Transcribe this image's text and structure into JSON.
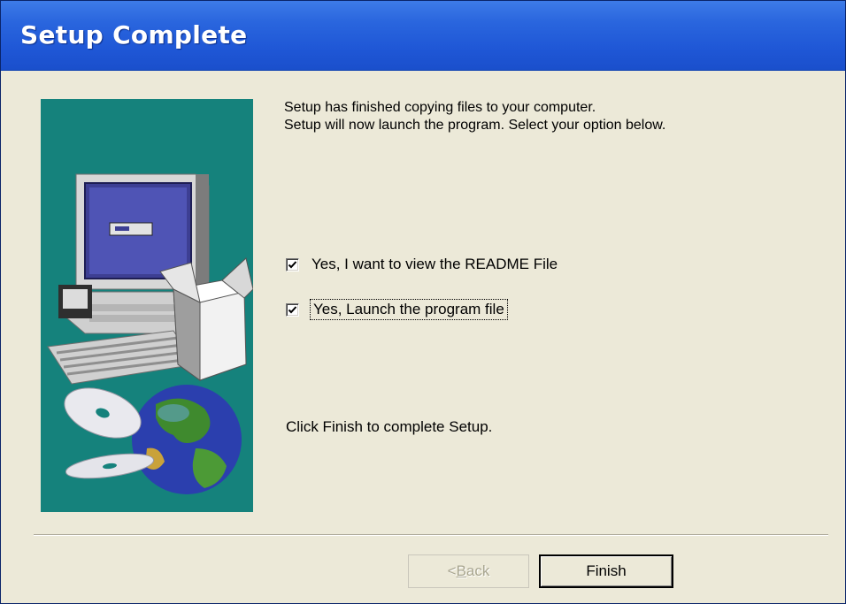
{
  "window": {
    "title": "Setup Complete"
  },
  "message": {
    "line1": "Setup has finished copying files to your computer.",
    "line2": "Setup will now launch the program. Select your option below."
  },
  "options": [
    {
      "label": "Yes, I want to view the README File",
      "checked": true
    },
    {
      "label": "Yes, Launch the program file",
      "checked": true
    }
  ],
  "hint": "Click Finish to complete Setup.",
  "buttons": {
    "back_prefix": "< ",
    "back_mnemonic": "B",
    "back_rest": "ack",
    "finish": "Finish"
  },
  "colors": {
    "titlebar": "#2a66de",
    "panel": "#ece9d8",
    "image_bg": "#15827c"
  },
  "icons": {
    "side_image": "computer-box-cd-globe-illustration",
    "check": "checkmark-icon"
  }
}
